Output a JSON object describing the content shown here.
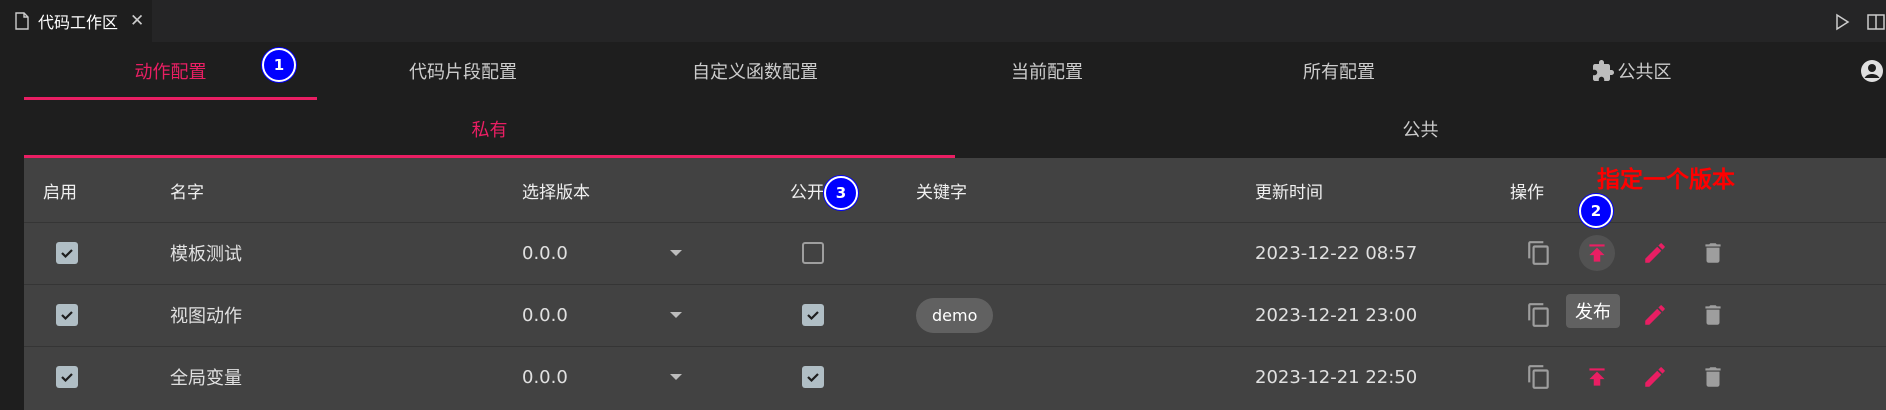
{
  "editor_tab": {
    "title": "代码工作区",
    "close": "✕",
    "icon": "file-icon"
  },
  "top_actions": [
    {
      "icon": "run-icon"
    },
    {
      "icon": "split-editor-icon"
    }
  ],
  "main_tabs": [
    {
      "label": "动作配置",
      "active": true
    },
    {
      "label": "代码片段配置"
    },
    {
      "label": "自定义函数配置"
    },
    {
      "label": "当前配置"
    },
    {
      "label": "所有配置"
    },
    {
      "label": "公共区",
      "icon": "puzzle-icon"
    },
    {
      "label": "",
      "icon": "account-icon"
    }
  ],
  "sub_tabs": [
    {
      "label": "私有",
      "active": true
    },
    {
      "label": "公共"
    }
  ],
  "table": {
    "headers": [
      "启用",
      "名字",
      "选择版本",
      "公开",
      "关键字",
      "更新时间",
      "操作"
    ],
    "rows": [
      {
        "enabled": true,
        "name": "模板测试",
        "version": "0.0.0",
        "public": false,
        "keyword": "",
        "updated": "2023-12-22 08:57"
      },
      {
        "enabled": true,
        "name": "视图动作",
        "version": "0.0.0",
        "public": true,
        "keyword": "demo",
        "updated": "2023-12-21 23:00"
      },
      {
        "enabled": true,
        "name": "全局变量",
        "version": "0.0.0",
        "public": true,
        "keyword": "",
        "updated": "2023-12-21 22:50"
      }
    ],
    "action_icons": [
      "copy-icon",
      "publish-icon",
      "edit-icon",
      "delete-icon"
    ]
  },
  "annotations": {
    "badge_1": "1",
    "badge_2": "2",
    "badge_3": "3",
    "note": "指定一个版本",
    "tooltip": "发布"
  },
  "colors": {
    "accent": "#e91e63",
    "table_bg": "#424242",
    "page_bg": "#1e1e1e",
    "badge": "#0000ff",
    "annotation": "#ff0000"
  }
}
